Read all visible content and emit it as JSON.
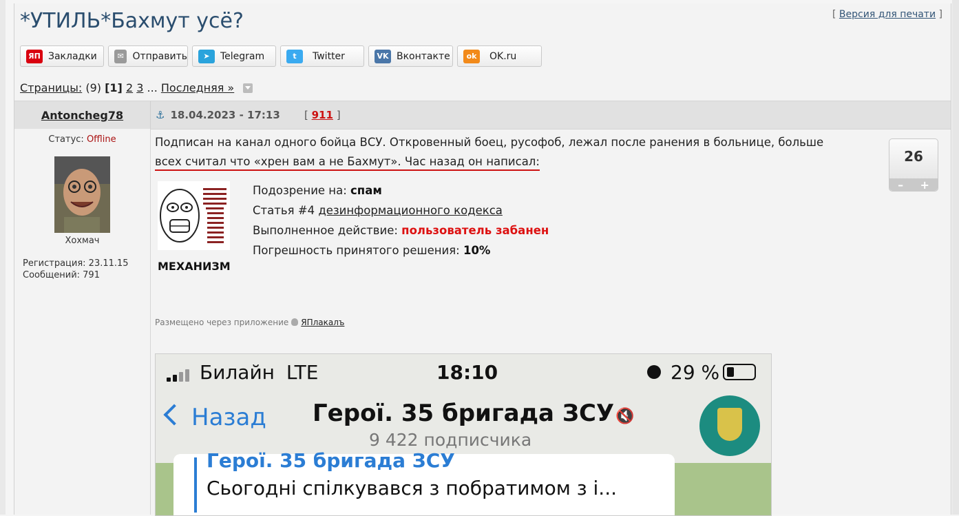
{
  "topic": {
    "title": "*УТИЛЬ*Бахмут усё?",
    "print_prefix": "[ ",
    "print_label": "Версия для печати",
    "print_suffix": " ]"
  },
  "share": [
    {
      "label": "Закладки",
      "icon": "ЯП",
      "color": "#d9000f"
    },
    {
      "label": "Отправить",
      "icon": "✉",
      "color": "#9a9a9a"
    },
    {
      "label": "Telegram",
      "icon": "➤",
      "color": "#2aa3dc"
    },
    {
      "label": "Twitter",
      "icon": "t",
      "color": "#3aaaf0"
    },
    {
      "label": "Вконтакте",
      "icon": "VK",
      "color": "#4a76a8"
    },
    {
      "label": "OK.ru",
      "icon": "ok",
      "color": "#f28a1a"
    }
  ],
  "pagination": {
    "label": "Страницы:",
    "count": "(9)",
    "current": "[1]",
    "p2": "2",
    "p3": "3",
    "ellipsis": "...",
    "last": "Последняя »"
  },
  "post": {
    "author": "Antoncheg78",
    "date": "18.04.2023 - 17:13",
    "number_open": "[ ",
    "number": "911",
    "number_close": " ]",
    "status_label": "Статус:",
    "status_value": "Offline",
    "user_title": "Хохмач",
    "reg": "Регистрация: 23.11.15",
    "msgs": "Сообщений: 791",
    "text_line1": "Подписан на канал одного бойца ВСУ. Откровенный боец, русофоб, лежал после ранения в больнице, больше",
    "text_line2": "всех считал что «хрен вам а не Бахмут». Час назад он написал:",
    "rating": "26",
    "rating_minus": "–",
    "rating_plus": "+",
    "via_label": "Размещено через приложение",
    "via_app": "ЯПлакалъ"
  },
  "mechanism": {
    "caption": "МЕХАНИЗМ",
    "suspicion_label": "Подозрение на:",
    "suspicion_value": "спам",
    "article_prefix": "Статья #4",
    "article_link": "дезинформационного кодекса",
    "action_label": "Выполненное действие:",
    "action_value": "пользователь забанен",
    "error_label": "Погрешность принятого решения:",
    "error_value": "10%"
  },
  "screenshot": {
    "carrier": "Билайн",
    "network": "LTE",
    "time": "18:10",
    "battery": "29 %",
    "back": "Назад",
    "channel": "Герої. 35 бригада ЗСУ",
    "subscribers": "9 422 подписчика",
    "quote_name": "Герої. 35 бригада ЗСУ",
    "quote_text": "Сьогодні спілкувався з побратимом з і..."
  }
}
